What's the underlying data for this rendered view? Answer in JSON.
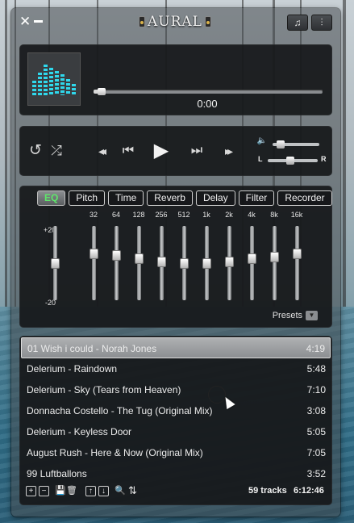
{
  "window": {
    "title": "AURAL",
    "close_glyph": "✕",
    "playlist_btn_icon": "♫",
    "mixer_btn_icon": "⫶"
  },
  "now_playing": {
    "time": "0:00",
    "progress": 0.02,
    "art_icon": "equalizer-bars-icon",
    "accent_color": "#2fd8ec"
  },
  "transport": {
    "repeat_icon": "↺",
    "shuffle_icon": "⤮",
    "rewind_icon": "◂◂",
    "prev_icon": "⏮",
    "play_icon": "▶",
    "next_icon": "⏭",
    "forward_icon": "▸▸",
    "volume_icon": "🔈",
    "volume_level": 0.1,
    "balance_level": 0.45,
    "balance_left": "L",
    "balance_right": "R"
  },
  "effects": {
    "tabs": [
      {
        "label": "EQ",
        "active": true
      },
      {
        "label": "Pitch"
      },
      {
        "label": "Time"
      },
      {
        "label": "Reverb"
      },
      {
        "label": "Delay"
      },
      {
        "label": "Filter"
      },
      {
        "label": "Recorder"
      }
    ],
    "active_color": "#5ee86a",
    "db_max": "+20",
    "db_zero": "0",
    "db_min": "-20",
    "preamp_level": 0.0,
    "bands": [
      {
        "label": "32",
        "level": 6
      },
      {
        "label": "64",
        "level": 5
      },
      {
        "label": "128",
        "level": 3
      },
      {
        "label": "256",
        "level": 1
      },
      {
        "label": "512",
        "level": 0
      },
      {
        "label": "1k",
        "level": 0
      },
      {
        "label": "2k",
        "level": 1
      },
      {
        "label": "4k",
        "level": 3
      },
      {
        "label": "8k",
        "level": 4
      },
      {
        "label": "16k",
        "level": 6
      }
    ],
    "presets_label": "Presets"
  },
  "playlist": {
    "tracks": [
      {
        "name": "01 Wish i could - Norah Jones",
        "duration": "4:19",
        "selected": true
      },
      {
        "name": "Delerium - Raindown",
        "duration": "5:48"
      },
      {
        "name": "Delerium - Sky (Tears from Heaven)",
        "duration": "7:10"
      },
      {
        "name": "Donnacha Costello - The Tug (Original Mix)",
        "duration": "3:08"
      },
      {
        "name": "Delerium - Keyless Door",
        "duration": "5:05"
      },
      {
        "name": "August Rush - Here & Now (Original Mix)",
        "duration": "7:05"
      },
      {
        "name": "99 Luftballons",
        "duration": "3:52"
      }
    ],
    "track_count": "59 tracks",
    "total_time": "6:12:46",
    "toolbar": {
      "add_icon": "+",
      "remove_icon": "−",
      "save_icon": "💾",
      "trash_icon": "🗑",
      "move_up_icon": "↑",
      "move_down_icon": "↓",
      "search_icon": "🔍",
      "sort_icon": "⇅"
    }
  }
}
